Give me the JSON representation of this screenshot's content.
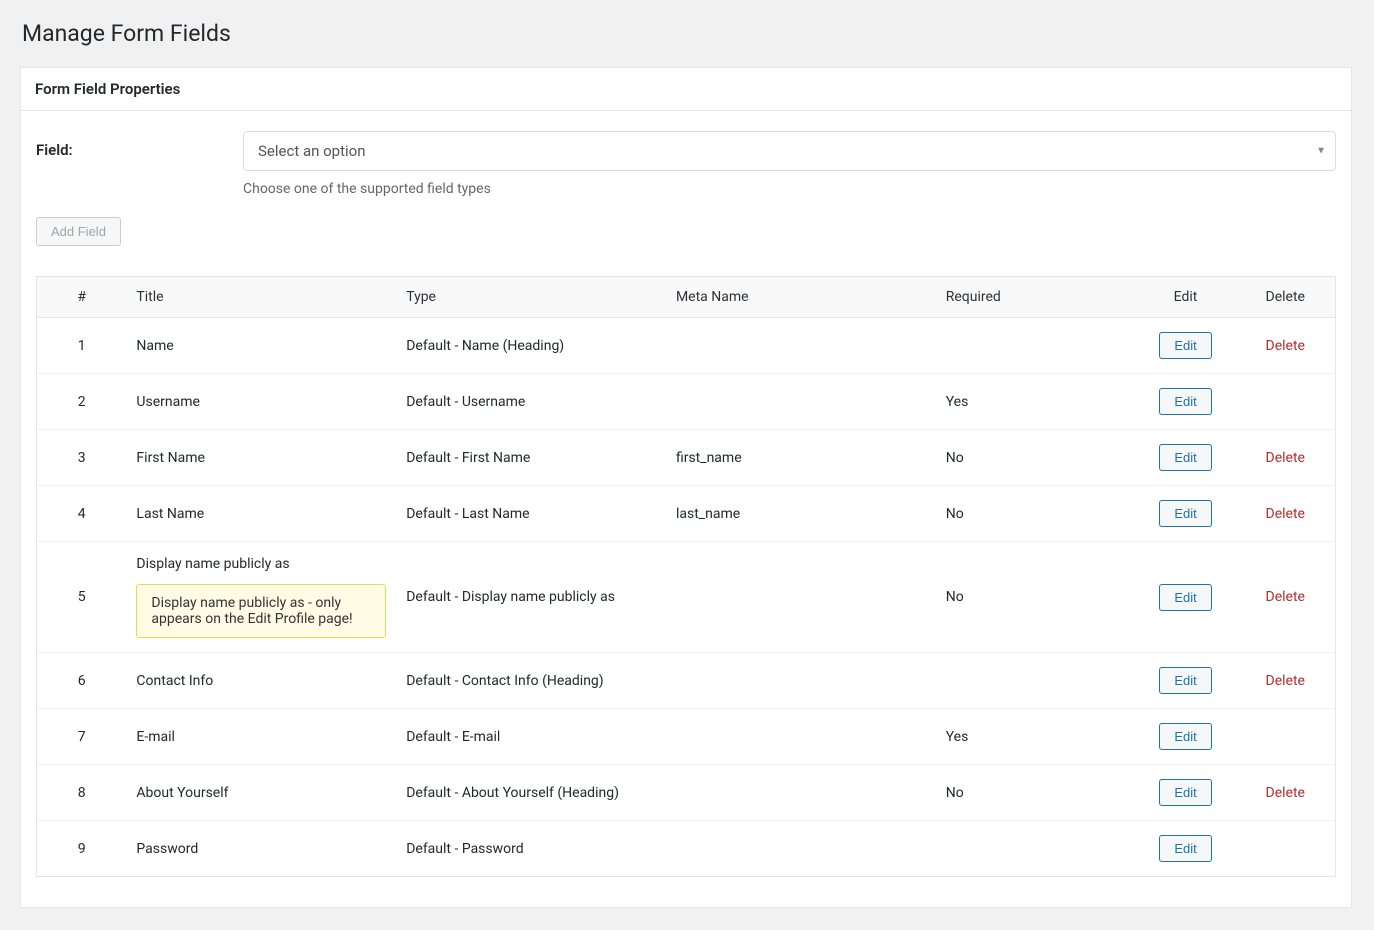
{
  "page": {
    "title": "Manage Form Fields"
  },
  "panel": {
    "header": "Form Field Properties"
  },
  "field_selector": {
    "label": "Field:",
    "placeholder": "Select an option",
    "description": "Choose one of the supported field types"
  },
  "add_field_button": "Add Field",
  "table": {
    "headers": {
      "index": "#",
      "title": "Title",
      "type": "Type",
      "meta_name": "Meta Name",
      "required": "Required",
      "edit": "Edit",
      "delete": "Delete"
    },
    "edit_label": "Edit",
    "delete_label": "Delete",
    "rows": [
      {
        "index": "1",
        "title": "Name",
        "type": "Default - Name (Heading)",
        "meta_name": "",
        "required": "",
        "has_delete": true,
        "notice": ""
      },
      {
        "index": "2",
        "title": "Username",
        "type": "Default - Username",
        "meta_name": "",
        "required": "Yes",
        "has_delete": false,
        "notice": ""
      },
      {
        "index": "3",
        "title": "First Name",
        "type": "Default - First Name",
        "meta_name": "first_name",
        "required": "No",
        "has_delete": true,
        "notice": ""
      },
      {
        "index": "4",
        "title": "Last Name",
        "type": "Default - Last Name",
        "meta_name": "last_name",
        "required": "No",
        "has_delete": true,
        "notice": ""
      },
      {
        "index": "5",
        "title": "Display name publicly as",
        "type": "Default - Display name publicly as",
        "meta_name": "",
        "required": "No",
        "has_delete": true,
        "notice": "Display name publicly as - only appears on the Edit Profile page!"
      },
      {
        "index": "6",
        "title": "Contact Info",
        "type": "Default - Contact Info (Heading)",
        "meta_name": "",
        "required": "",
        "has_delete": true,
        "notice": ""
      },
      {
        "index": "7",
        "title": "E-mail",
        "type": "Default - E-mail",
        "meta_name": "",
        "required": "Yes",
        "has_delete": false,
        "notice": ""
      },
      {
        "index": "8",
        "title": "About Yourself",
        "type": "Default - About Yourself (Heading)",
        "meta_name": "",
        "required": "No",
        "has_delete": true,
        "notice": ""
      },
      {
        "index": "9",
        "title": "Password",
        "type": "Default - Password",
        "meta_name": "",
        "required": "",
        "has_delete": false,
        "notice": ""
      }
    ]
  }
}
